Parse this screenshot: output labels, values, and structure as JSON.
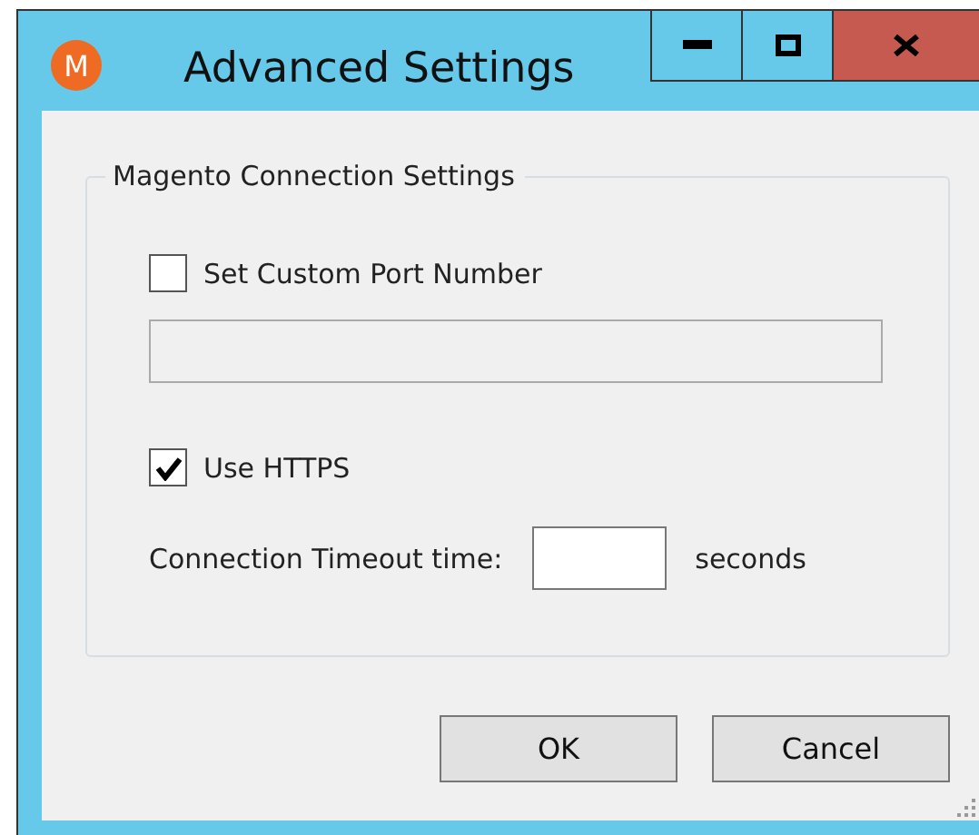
{
  "window": {
    "title": "Advanced Settings",
    "logo_letter": "M"
  },
  "group": {
    "title": "Magento Connection Settings",
    "port": {
      "label": "Set Custom Port Number",
      "checked": false,
      "disabled": true
    },
    "https": {
      "label": "Use HTTPS",
      "checked": true
    },
    "timeout": {
      "label": "Connection Timeout time:",
      "unit": "seconds"
    }
  },
  "buttons": [
    "OK",
    "Cancel"
  ]
}
